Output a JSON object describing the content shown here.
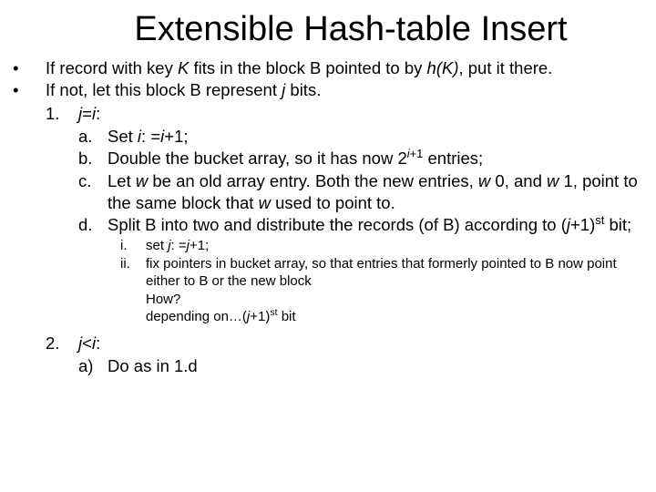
{
  "title": "Extensible Hash-table Insert",
  "b1_pre": "If record with key ",
  "b1_K": "K",
  "b1_mid1": " fits in the block B pointed to by ",
  "b1_hK": "h(K)",
  "b1_post": ", put it there.",
  "b2_pre": "If not, let this block B represent ",
  "b2_j": "j",
  "b2_post": " bits.",
  "n1_marker": "1.",
  "n1_j": "j",
  "n1_eq": "=",
  "n1_i": "i",
  "n1_colon": ":",
  "a_marker": "a.",
  "a_pre": "Set ",
  "a_i": "i",
  "a_mid": ": =",
  "a_i2": "i",
  "a_post": "+1;",
  "bb_marker": "b.",
  "bb_pre": "Double the bucket array, so it has now 2",
  "bb_sup_i": "i",
  "bb_sup_post": "+1",
  "bb_post": " entries;",
  "c_marker": "c.",
  "c_pre": "Let ",
  "c_w": "w",
  "c_mid": " be an old array entry. Both the new entries, ",
  "c_w0": "w",
  "c_0": " 0, and ",
  "c_w1": "w",
  "c_1": " 1, point to the same block that ",
  "c_w2": "w",
  "c_post": " used to point to.",
  "d_marker": "d.",
  "d_pre": "Split B into two and distribute the records (of B) according to (",
  "d_j": "j",
  "d_mid": "+1)",
  "d_st": "st",
  "d_post": " bit;",
  "r1_marker": "i.",
  "r1_pre": "set ",
  "r1_j": "j",
  "r1_mid": ": =",
  "r1_j2": "j",
  "r1_post": "+1;",
  "r2_marker": "ii.",
  "r2_text": "fix pointers in bucket array, so that entries that formerly pointed to B now point either to B or the new block",
  "r3_text": "How?",
  "r4_pre": "depending on…(",
  "r4_j": "j",
  "r4_mid": "+1)",
  "r4_st": "st",
  "r4_post": " bit",
  "n2_marker": "2.",
  "n2_j": "j",
  "n2_lt": "<",
  "n2_i": "i",
  "n2_colon": ":",
  "aa_marker": "a)",
  "aa_text": "Do as in 1.d"
}
